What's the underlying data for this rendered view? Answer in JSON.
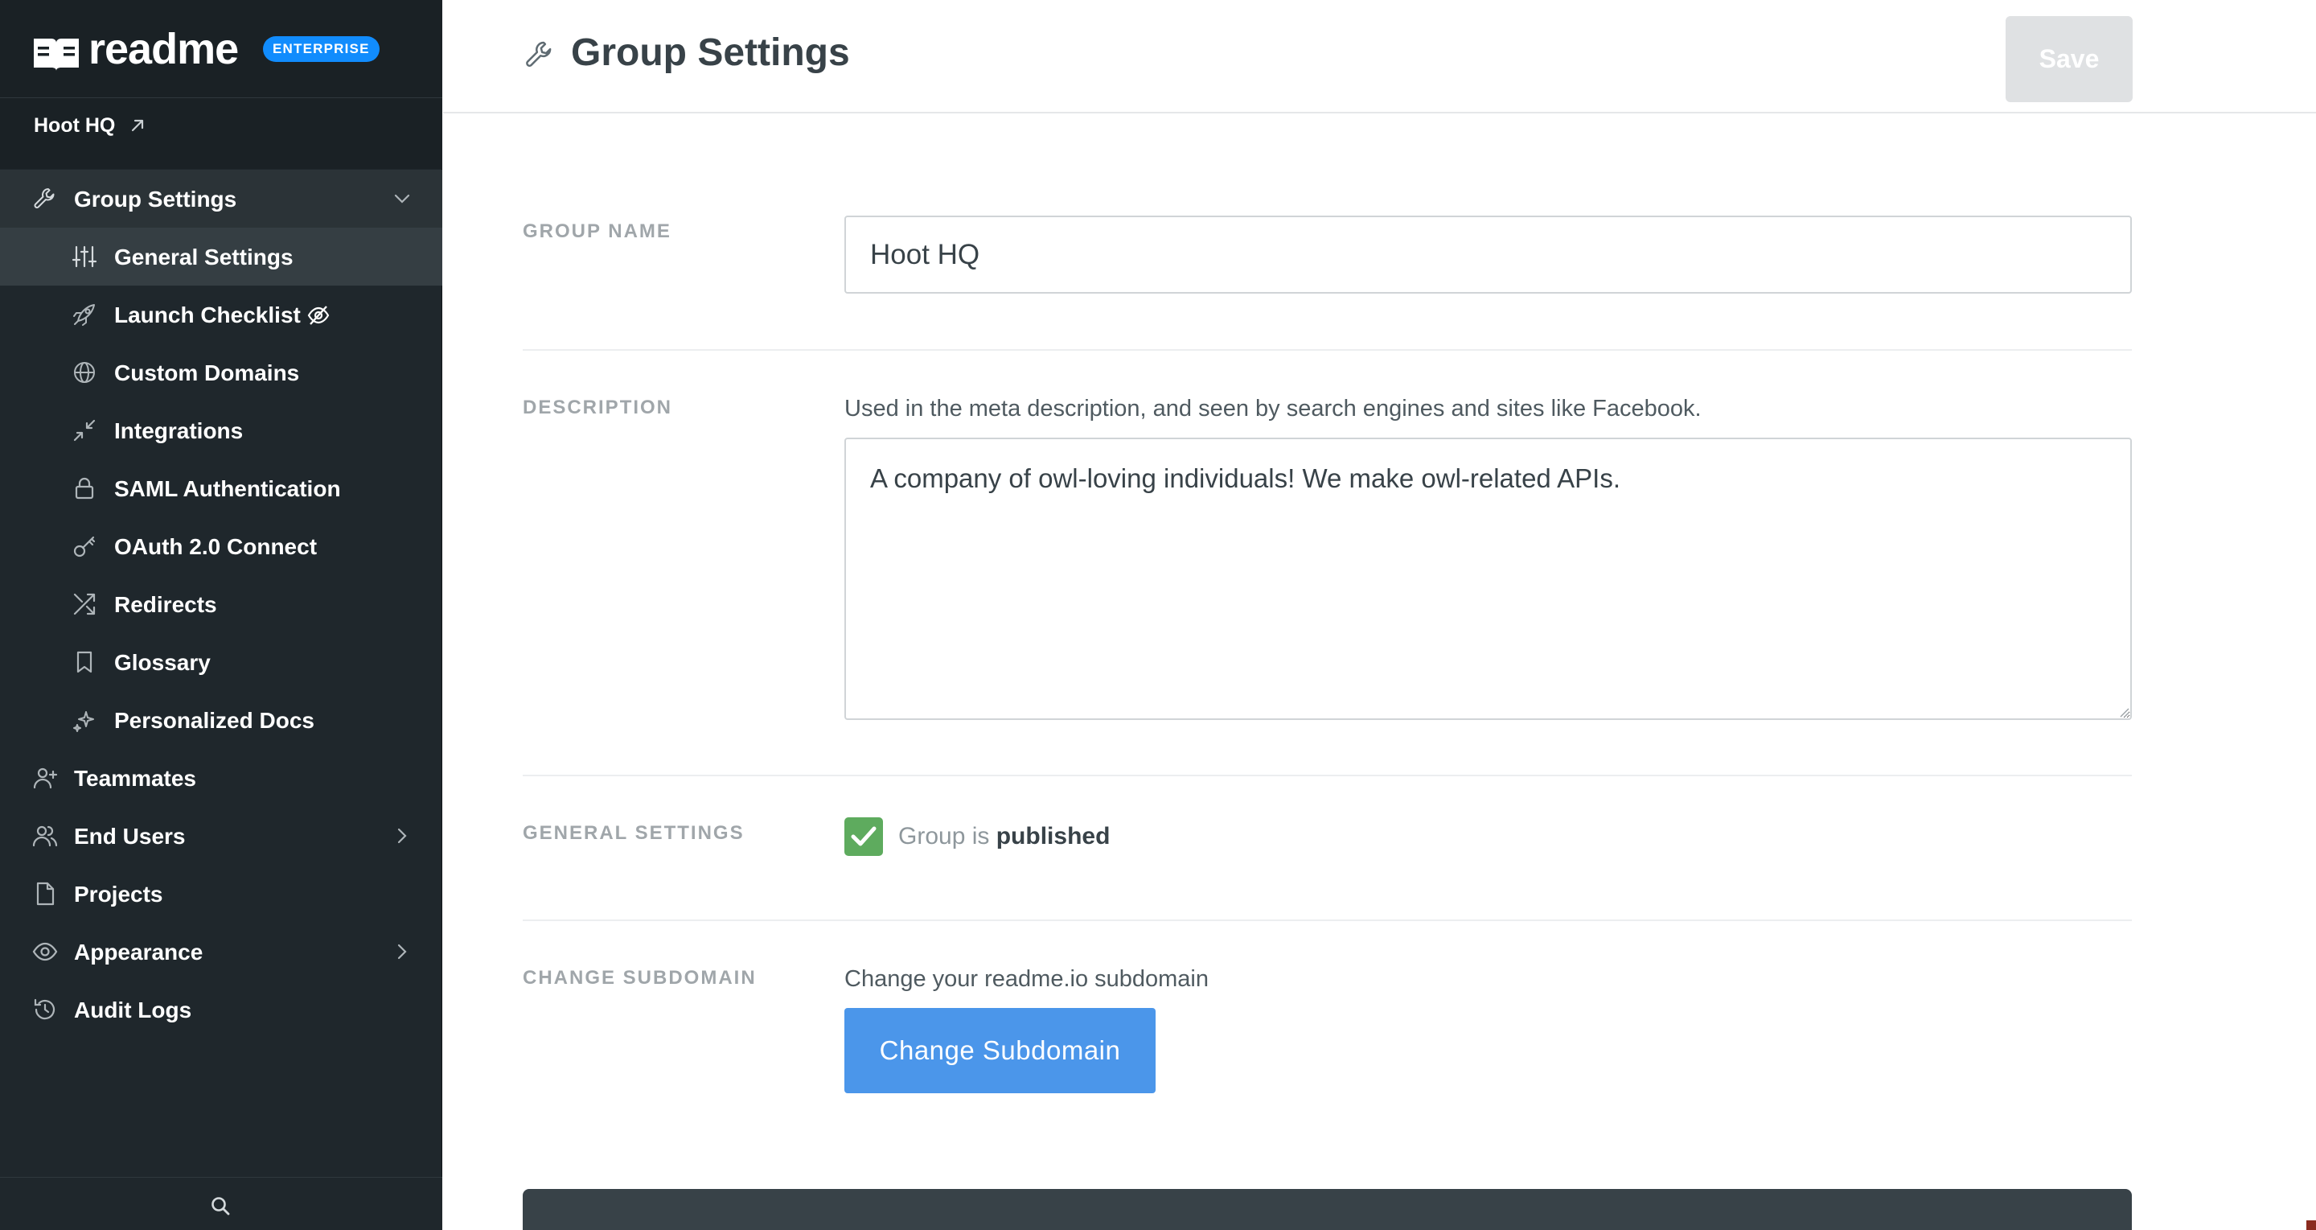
{
  "sidebar": {
    "brand": {
      "wordmark": "readme",
      "badge": "ENTERPRISE"
    },
    "project": {
      "name": "Hoot HQ",
      "icon": "external-arrow-icon"
    },
    "nav": {
      "group_settings": {
        "label": "Group Settings",
        "icon": "wrench-icon",
        "expanded": true
      },
      "sub_items": [
        {
          "label": "General Settings",
          "icon": "sliders-icon",
          "active": true
        },
        {
          "label": "Launch Checklist",
          "icon": "rocket-icon",
          "badge_icon": "eye-off-icon"
        },
        {
          "label": "Custom Domains",
          "icon": "globe-icon"
        },
        {
          "label": "Integrations",
          "icon": "arrows-in-icon"
        },
        {
          "label": "SAML Authentication",
          "icon": "lock-icon"
        },
        {
          "label": "OAuth 2.0 Connect",
          "icon": "key-icon"
        },
        {
          "label": "Redirects",
          "icon": "shuffle-icon"
        },
        {
          "label": "Glossary",
          "icon": "bookmark-icon"
        },
        {
          "label": "Personalized Docs",
          "icon": "sparkles-icon"
        }
      ],
      "top_items": [
        {
          "label": "Teammates",
          "icon": "user-plus-icon"
        },
        {
          "label": "End Users",
          "icon": "users-icon",
          "has_children": true
        },
        {
          "label": "Projects",
          "icon": "file-icon"
        },
        {
          "label": "Appearance",
          "icon": "eye-icon",
          "has_children": true
        },
        {
          "label": "Audit Logs",
          "icon": "history-icon"
        }
      ]
    },
    "search_icon": "search-icon"
  },
  "header": {
    "title": "Group Settings",
    "icon": "wrench-icon",
    "save_label": "Save"
  },
  "form": {
    "group_name": {
      "label": "GROUP NAME",
      "value": "Hoot HQ"
    },
    "description": {
      "label": "DESCRIPTION",
      "help": "Used in the meta description, and seen by search engines and sites like Facebook.",
      "value": "A company of owl-loving individuals! We make owl-related APIs."
    },
    "general_settings": {
      "label": "GENERAL SETTINGS",
      "checkbox_prefix": "Group is",
      "checkbox_strong": "published",
      "checked": true
    },
    "change_subdomain": {
      "label": "CHANGE SUBDOMAIN",
      "help": "Change your readme.io subdomain",
      "button_label": "Change Subdomain"
    }
  },
  "colors": {
    "sidebar_bg": "#1f272c",
    "accent_blue": "#118cfd",
    "button_blue": "#4b96ea",
    "check_green": "#5eab5e",
    "save_disabled": "#dfe1e3"
  }
}
